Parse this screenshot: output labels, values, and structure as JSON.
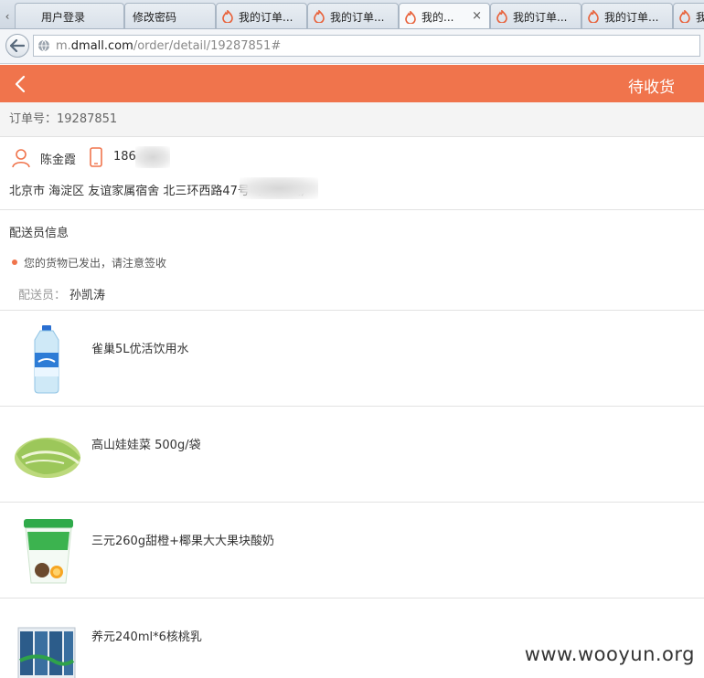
{
  "browser": {
    "tabs": [
      {
        "label": "用户登录",
        "active": false
      },
      {
        "label": "修改密码",
        "active": false
      },
      {
        "label": "我的订单...",
        "active": false
      },
      {
        "label": "我的订单...",
        "active": false
      },
      {
        "label": "我的...",
        "active": true
      },
      {
        "label": "我的订单...",
        "active": false
      },
      {
        "label": "我的订单...",
        "active": false
      },
      {
        "label": "我",
        "active": false
      }
    ],
    "tab_close": "×",
    "tab_scroll_left": "‹",
    "url_prefix": "m.",
    "url_host": "dmall.com",
    "url_path": "/order/detail/19287851#"
  },
  "header": {
    "status": "待收货",
    "accent_color": "#f0744c"
  },
  "order": {
    "number_label": "订单号：19287851"
  },
  "contact": {
    "name": "陈金霞",
    "phone": "186          459",
    "address": "北京市 海淀区 友谊家属宿舍 北三环西路47号                       号（二楼）"
  },
  "courier": {
    "section_title": "配送员信息",
    "notice": "您的货物已发出，请注意签收",
    "label": "配送员：",
    "name": "孙凯涛"
  },
  "items": [
    {
      "name": "雀巢5L优活饮用水",
      "icon": "water-bottle-icon"
    },
    {
      "name": "高山娃娃菜 500g/袋",
      "icon": "cabbage-icon"
    },
    {
      "name": "三元260g甜橙+椰果大大果块酸奶",
      "icon": "yogurt-cup-icon"
    },
    {
      "name": "养元240ml*6核桃乳",
      "icon": "walnut-milk-pack-icon"
    }
  ],
  "watermark": "www.wooyun.org"
}
